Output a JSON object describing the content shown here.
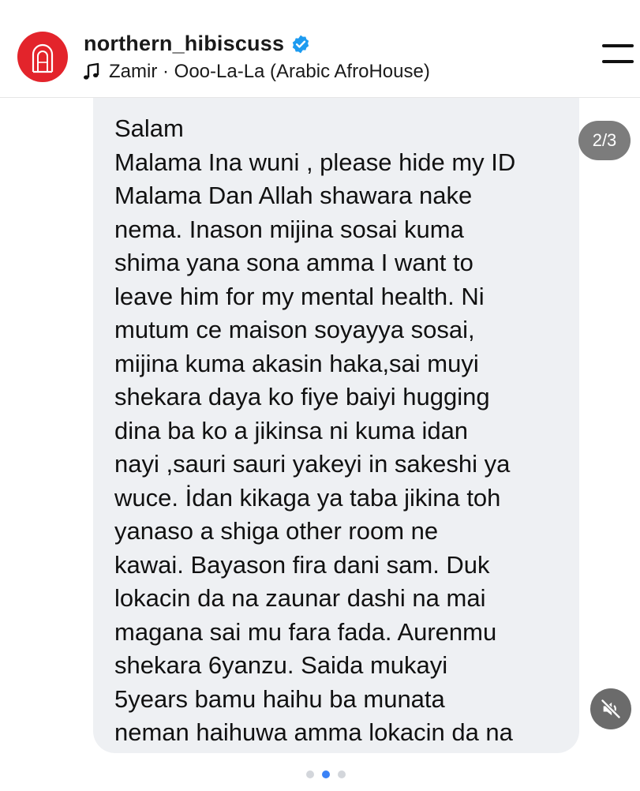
{
  "post_header": {
    "username": "northern_hibiscuss",
    "verified": true,
    "music": "Zamir · Ooo-La-La (Arabic AfroHouse)",
    "avatar_color": "#e3242b",
    "verified_color": "#1d9bf0"
  },
  "carousel": {
    "counter": "2/3",
    "active_index": 2,
    "total": 3
  },
  "message": {
    "lines": [
      "Salam",
      "Malama Ina wuni , please hide my ID",
      "Malama Dan Allah shawara nake",
      "nema. Inason mijina sosai kuma",
      "shima yana sona amma I want to",
      "leave him for my mental health. Ni",
      "mutum ce maison soyayya sosai,",
      "mijina kuma akasin haka,sai muyi",
      "shekara daya ko fiye baiyi hugging",
      "dina ba ko a jikinsa ni kuma idan",
      "nayi ,sauri sauri yakeyi in sakeshi ya",
      "wuce. İdan kikaga ya taba jikina toh",
      "yanaso a shiga other room ne",
      "kawai. Bayason fira dani sam. Duk",
      "lokacin da na zaunar dashi na mai",
      "magana sai mu fara fada. Aurenmu",
      "shekara 6yanzu. Saida mukayi",
      "5years bamu haihu ba munata",
      "neman haihuwa amma lokacin da na"
    ]
  },
  "icons": {
    "avatar": "hibiscus-arch-logo",
    "verified": "verified-badge-icon",
    "music": "music-note-icon",
    "menu": "menu-icon",
    "mute": "speaker-muted-icon"
  }
}
